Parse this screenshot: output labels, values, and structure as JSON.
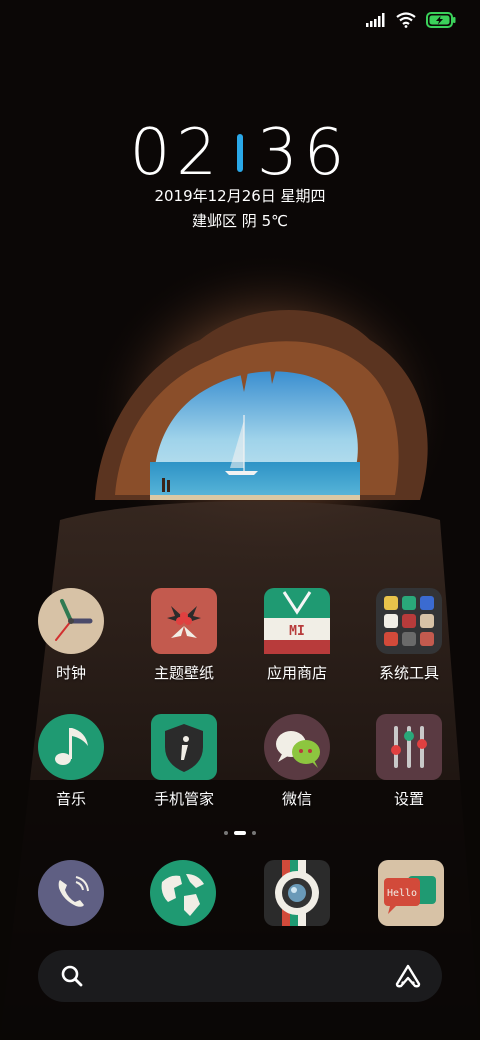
{
  "status_bar": {
    "signal_icon": "signal-bars-icon",
    "wifi_icon": "wifi-icon",
    "battery_icon": "battery-charging-icon",
    "accent": "#3bd15a"
  },
  "lockscreen": {
    "hours": "02",
    "minutes": "36",
    "date": "2019年12月26日  星期四",
    "weather": "建邺区   阴   5℃",
    "accent": "#2aa8e8"
  },
  "apps_row1": [
    {
      "label": "时钟",
      "icon": "clock-icon"
    },
    {
      "label": "主题壁纸",
      "icon": "holly-theme-icon"
    },
    {
      "label": "应用商店",
      "icon": "mi-store-bag-icon"
    },
    {
      "label": "系统工具",
      "icon": "folder-icon"
    }
  ],
  "apps_row2": [
    {
      "label": "音乐",
      "icon": "music-note-icon"
    },
    {
      "label": "手机管家",
      "icon": "security-shield-icon"
    },
    {
      "label": "微信",
      "icon": "wechat-chat-icon"
    },
    {
      "label": "设置",
      "icon": "settings-sliders-icon"
    }
  ],
  "page_indicator": {
    "pages": 3,
    "current": 1
  },
  "dock": [
    {
      "icon": "phone-icon"
    },
    {
      "icon": "browser-globe-icon"
    },
    {
      "icon": "camera-icon"
    },
    {
      "icon": "messages-hello-icon",
      "text": "Hello"
    }
  ],
  "search_bar": {
    "search_icon": "search-icon",
    "assistant_icon": "assistant-icon"
  }
}
